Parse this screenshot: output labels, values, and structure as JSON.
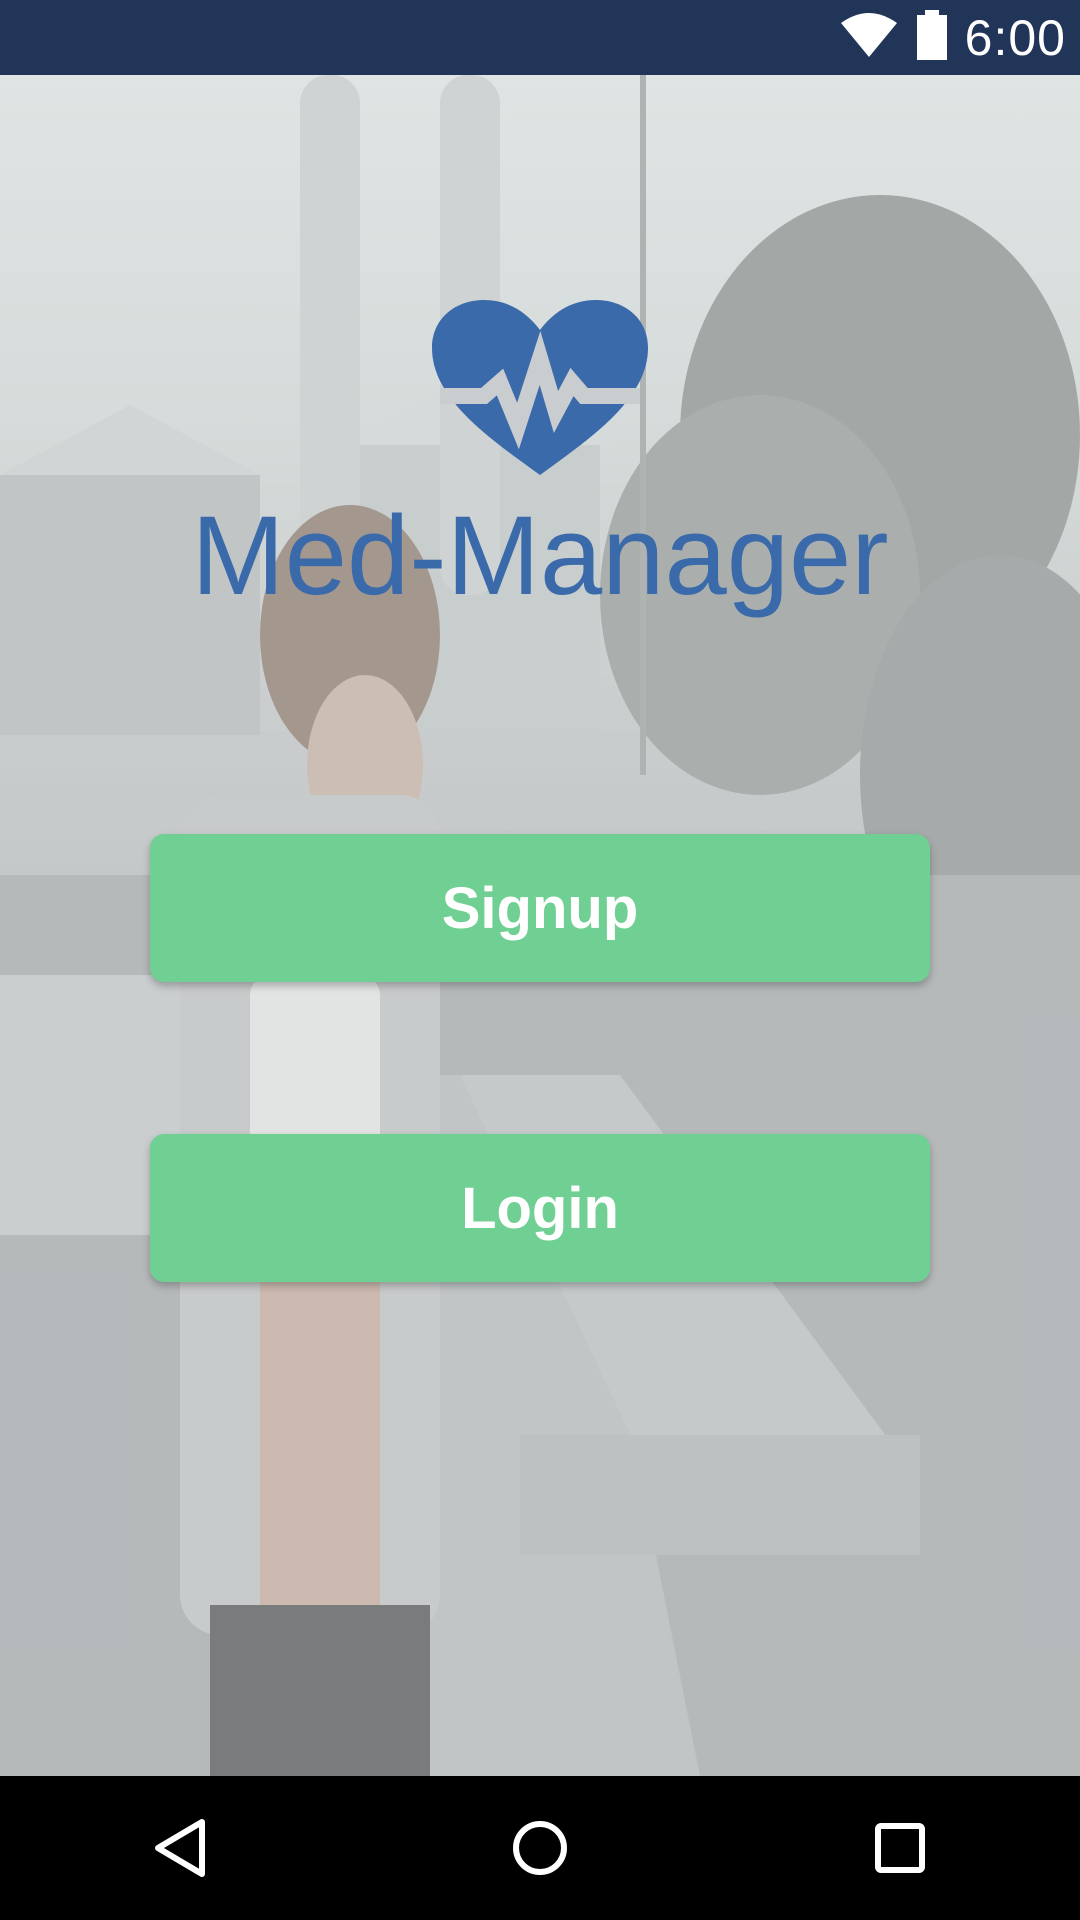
{
  "status_bar": {
    "time": "6:00",
    "icons": [
      "wifi-icon",
      "battery-icon"
    ],
    "background": "#213558"
  },
  "app": {
    "title": "Med-Manager",
    "logo_icon": "heart-pulse-icon",
    "brand_color": "#3a6aaa"
  },
  "actions": {
    "signup_label": "Signup",
    "login_label": "Login",
    "button_color": "#70cf92"
  },
  "nav_bar": {
    "icons": [
      "back-icon",
      "home-icon",
      "recents-icon"
    ]
  }
}
